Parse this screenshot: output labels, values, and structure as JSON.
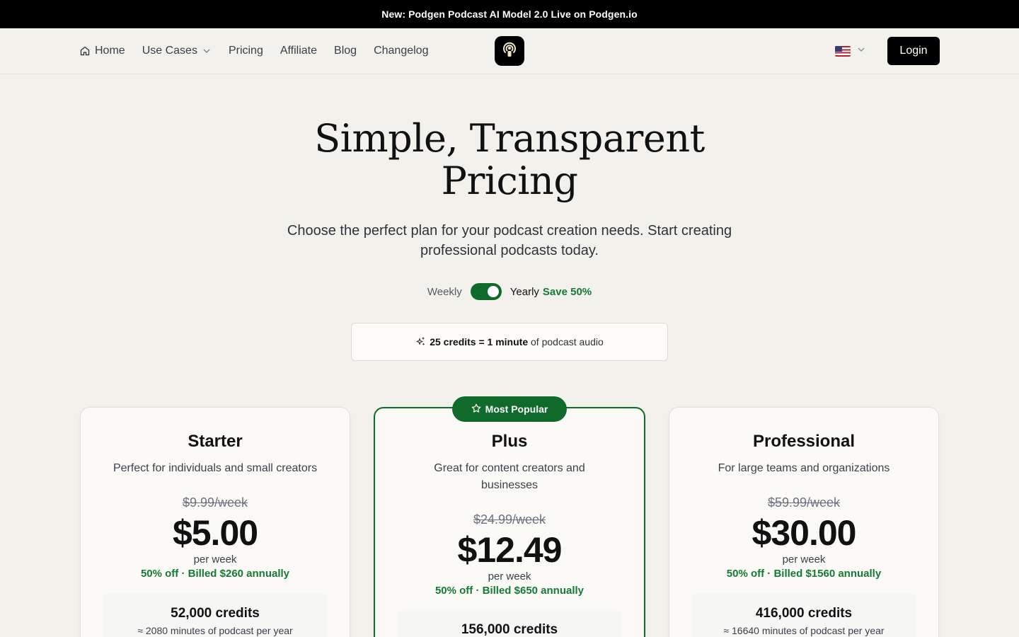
{
  "announcement": "New: Podgen Podcast AI Model 2.0 Live on Podgen.io",
  "nav": {
    "home": "Home",
    "use_cases": "Use Cases",
    "pricing": "Pricing",
    "affiliate": "Affiliate",
    "blog": "Blog",
    "changelog": "Changelog",
    "language_flag": "us-flag",
    "login": "Login"
  },
  "hero": {
    "title": "Simple, Transparent Pricing",
    "subtitle": "Choose the perfect plan for your podcast creation needs. Start creating professional podcasts today."
  },
  "billing_toggle": {
    "weekly": "Weekly",
    "yearly": "Yearly",
    "save": "Save 50%",
    "selected": "yearly"
  },
  "credits_note": {
    "bold": "25 credits = 1 minute",
    "rest": "of podcast audio"
  },
  "popular_badge": "Most Popular",
  "plans": [
    {
      "name": "Starter",
      "description": "Perfect for individuals and small creators",
      "old_price": "$9.99/week",
      "price": "$5.00",
      "per": "per week",
      "billed": "50% off · Billed $260 annually",
      "credits": "52,000 credits",
      "minutes": "≈ 2080 minutes of podcast per year"
    },
    {
      "name": "Plus",
      "description": "Great for content creators and businesses",
      "old_price": "$24.99/week",
      "price": "$12.49",
      "per": "per week",
      "billed": "50% off · Billed $650 annually",
      "credits": "156,000 credits",
      "minutes": ""
    },
    {
      "name": "Professional",
      "description": "For large teams and organizations",
      "old_price": "$59.99/week",
      "price": "$30.00",
      "per": "per week",
      "billed": "50% off · Billed $1560 annually",
      "credits": "416,000 credits",
      "minutes": "≈ 16640 minutes of podcast per year"
    }
  ],
  "colors": {
    "accent_green": "#0f6a2b",
    "save_green": "#157a34",
    "background": "#f3f1ec",
    "announcement_bg": "#000000"
  }
}
